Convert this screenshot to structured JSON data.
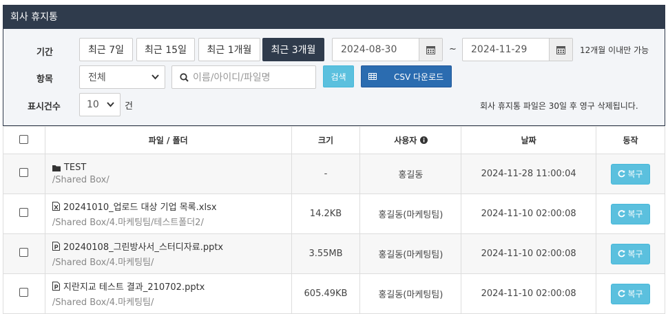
{
  "panel": {
    "title": "회사 휴지통"
  },
  "filter": {
    "period_label": "기간",
    "quick_ranges": [
      "최근 7일",
      "최근 15일",
      "최근 1개월",
      "최근 3개월"
    ],
    "active_range": "최근 3개월",
    "date_from": "2024-08-30",
    "date_sep": "~",
    "date_to": "2024-11-29",
    "range_note": "12개월 이내만 가능",
    "item_label": "항목",
    "item_value": "전체",
    "search_placeholder": "이름/아이디/파일명",
    "search_button": "검색",
    "csv_button": "CSV 다운로드",
    "count_label": "표시건수",
    "count_value": "10",
    "count_unit": "건",
    "delete_note": "회사 휴지통 파일은 30일 후 영구 삭제됩니다."
  },
  "table": {
    "headers": {
      "file": "파일 / 폴더",
      "size": "크기",
      "user": "사용자",
      "date": "날짜",
      "action": "동작"
    },
    "restore_label": "복구",
    "rows": [
      {
        "icon": "folder-icon",
        "name": "TEST",
        "path": "/Shared Box/",
        "size": "-",
        "user": "홍길동",
        "date": "2024-11-28 11:00:04"
      },
      {
        "icon": "excel-file-icon",
        "name": "20241010_업로드 대상 기업 목록.xlsx",
        "path": "/Shared Box/4.마케팅팀/테스트폴더2/",
        "size": "14.2KB",
        "user": "홍길동(마케팅팀)",
        "date": "2024-11-10 02:00:08"
      },
      {
        "icon": "powerpoint-file-icon",
        "name": "20240108_그린방사서_스터디자료.pptx",
        "path": "/Shared Box/4.마케팅팀/",
        "size": "3.55MB",
        "user": "홍길동(마케팅팀)",
        "date": "2024-11-10 02:00:08"
      },
      {
        "icon": "powerpoint-file-icon",
        "name": "지란지교 테스트 결과_210702.pptx",
        "path": "/Shared Box/4.마케팅팀/",
        "size": "605.49KB",
        "user": "홍길동(마케팅팀)",
        "date": "2024-11-10 02:00:08"
      }
    ]
  }
}
